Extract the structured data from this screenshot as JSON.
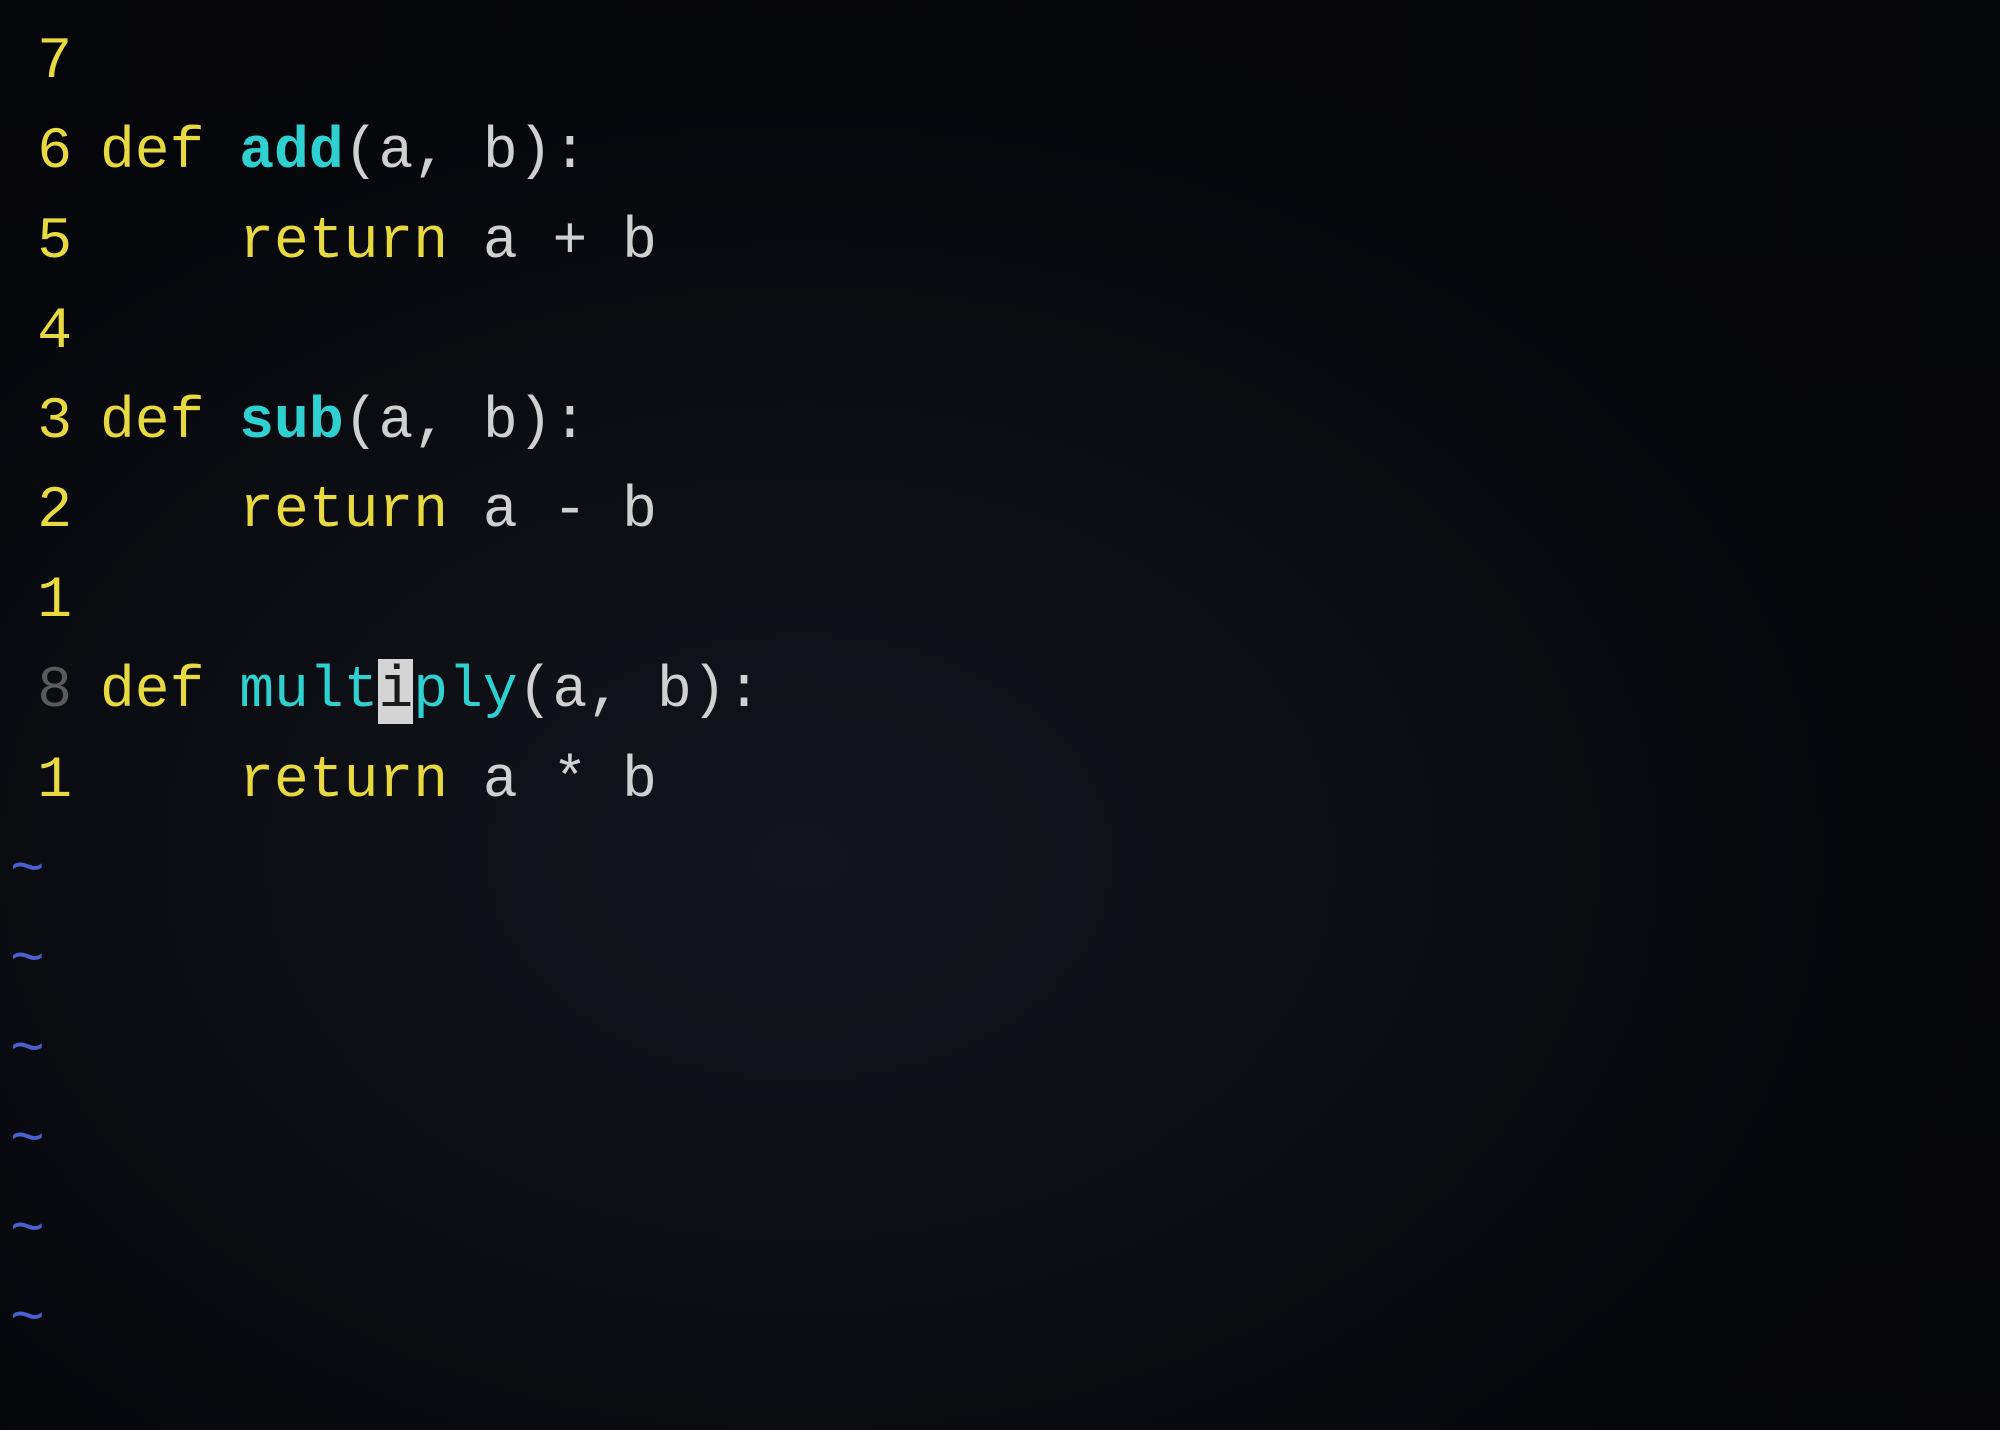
{
  "gutter": {
    "relnums": [
      "7",
      "6",
      "5",
      "4",
      "3",
      "2",
      "1",
      "8",
      "1"
    ],
    "tilde": "~"
  },
  "code": {
    "kw_def": "def ",
    "kw_return": "return ",
    "indent": "    ",
    "fn_add": "add",
    "fn_sub": "sub",
    "fn_mult_pre": "mult",
    "fn_mult_cur": "i",
    "fn_mult_post": "ply",
    "params_open": "(",
    "params_a": "a",
    "params_sep": ", ",
    "params_b": "b",
    "params_close": ")",
    "colon": ":",
    "expr_add": "a + b",
    "expr_sub": "a - b",
    "expr_mul": "a * b"
  }
}
